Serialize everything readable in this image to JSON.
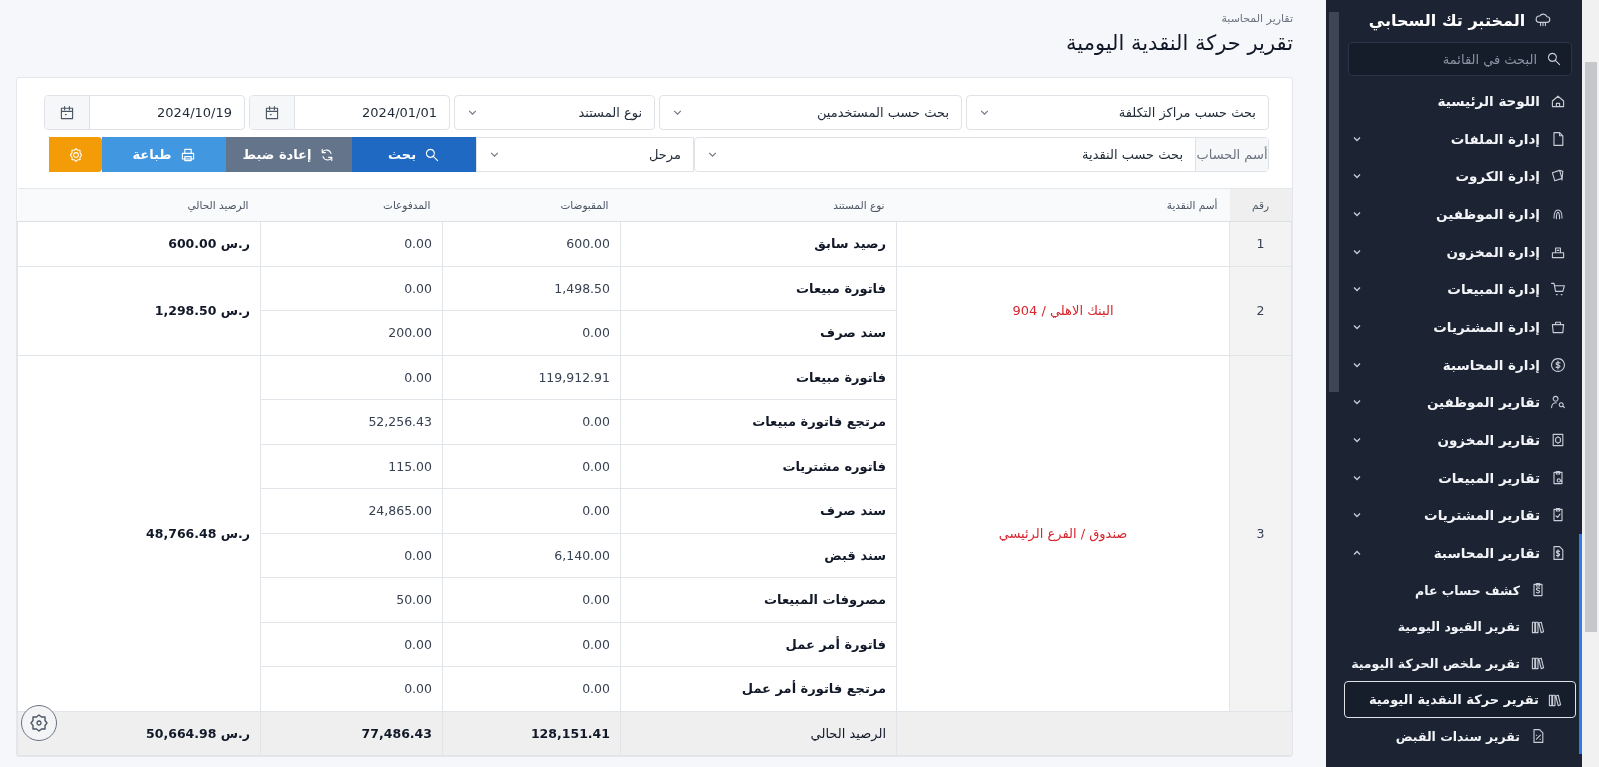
{
  "sidebar": {
    "brand": "المختبر تك السحابي",
    "search": {
      "placeholder": "البحث في القائمة"
    },
    "items": [
      {
        "kind": "link",
        "label": "اللوحة الرئيسية"
      },
      {
        "kind": "group",
        "label": "إدارة الملفات",
        "expanded": false
      },
      {
        "kind": "group",
        "label": "إدارة الكروت",
        "expanded": false
      },
      {
        "kind": "group",
        "label": "إدارة الموظفين",
        "expanded": false
      },
      {
        "kind": "group",
        "label": "إدارة المخزون",
        "expanded": false
      },
      {
        "kind": "group",
        "label": "إدارة المبيعات",
        "expanded": false
      },
      {
        "kind": "group",
        "label": "إدارة المشتريات",
        "expanded": false
      },
      {
        "kind": "group",
        "label": "إدارة المحاسبة",
        "expanded": false
      },
      {
        "kind": "group",
        "label": "تقارير الموظفين",
        "expanded": false
      },
      {
        "kind": "group",
        "label": "تقارير المخزون",
        "expanded": false
      },
      {
        "kind": "group",
        "label": "تقارير المبيعات",
        "expanded": false
      },
      {
        "kind": "group",
        "label": "تقارير المشتريات",
        "expanded": false
      },
      {
        "kind": "group",
        "label": "تقارير المحاسبة",
        "expanded": true,
        "children": [
          {
            "label": "كشف حساب عام",
            "selected": false
          },
          {
            "label": "تقرير القيود اليومية",
            "selected": false
          },
          {
            "label": "تقرير ملخص الحركة اليومية",
            "selected": false
          },
          {
            "label": "تقرير حركة النقدية اليومية",
            "selected": true
          },
          {
            "label": "تقرير سندات القبض",
            "selected": false
          }
        ]
      }
    ]
  },
  "breadcrumb": "تقارير المحاسبة",
  "title": "تقرير حركة النقدية اليومية",
  "filters": {
    "cost_center": "بحث حسب مراكز التكلفة",
    "users": "بحث حسب المستخدمين",
    "doc_type": "نوع المستند",
    "date_from": "2024/01/01",
    "date_to": "2024/10/19",
    "account_label": "أسم الحساب",
    "account": "بحث حسب النقدية",
    "posted": "مرحل"
  },
  "buttons": [
    {
      "kind": "search",
      "label": "بحث"
    },
    {
      "kind": "reset",
      "label": "إعادة ضبط"
    },
    {
      "kind": "print",
      "label": "طباعة"
    },
    {
      "kind": "settings"
    }
  ],
  "table": {
    "columns": [
      "رقم",
      "أسم النقدية",
      "نوع المستند",
      "المقبوضات",
      "المدفوعات",
      "الرصيد الحالي"
    ],
    "groups": [
      {
        "number": "1",
        "balance": "600.00 ر.س",
        "rows": [
          {
            "doc_type": "رصيد سابق",
            "receipts": "600.00",
            "payments": "0.00"
          }
        ]
      },
      {
        "number": "2",
        "name": "البنك الاهلي / 904",
        "balance": "1,298.50 ر.س",
        "rows": [
          {
            "doc_type": "فاتورة مبيعات",
            "receipts": "1,498.50",
            "payments": "0.00"
          },
          {
            "doc_type": "سند صرف",
            "receipts": "0.00",
            "payments": "200.00"
          }
        ]
      },
      {
        "number": "3",
        "name": "صندوق / الفرع الرئيسي",
        "balance": "48,766.48 ر.س",
        "rows": [
          {
            "doc_type": "فاتورة مبيعات",
            "receipts": "119,912.91",
            "payments": "0.00"
          },
          {
            "doc_type": "مرتجع فاتورة مبيعات",
            "receipts": "0.00",
            "payments": "52,256.43"
          },
          {
            "doc_type": "فاتوره مشتريات",
            "receipts": "0.00",
            "payments": "115.00"
          },
          {
            "doc_type": "سند صرف",
            "receipts": "0.00",
            "payments": "24,865.00"
          },
          {
            "doc_type": "سند قبض",
            "receipts": "6,140.00",
            "payments": "0.00"
          },
          {
            "doc_type": "مصروفات المبيعات",
            "receipts": "0.00",
            "payments": "50.00"
          },
          {
            "doc_type": "فاتورة أمر عمل",
            "receipts": "0.00",
            "payments": "0.00"
          },
          {
            "doc_type": "مرتجع فاتورة أمر عمل",
            "receipts": "0.00",
            "payments": "0.00"
          }
        ]
      }
    ],
    "footer": {
      "label": "الرصيد الحالي",
      "receipts": "128,151.41",
      "payments": "77,486.43",
      "balance": "50,664.98 ر.س"
    }
  }
}
